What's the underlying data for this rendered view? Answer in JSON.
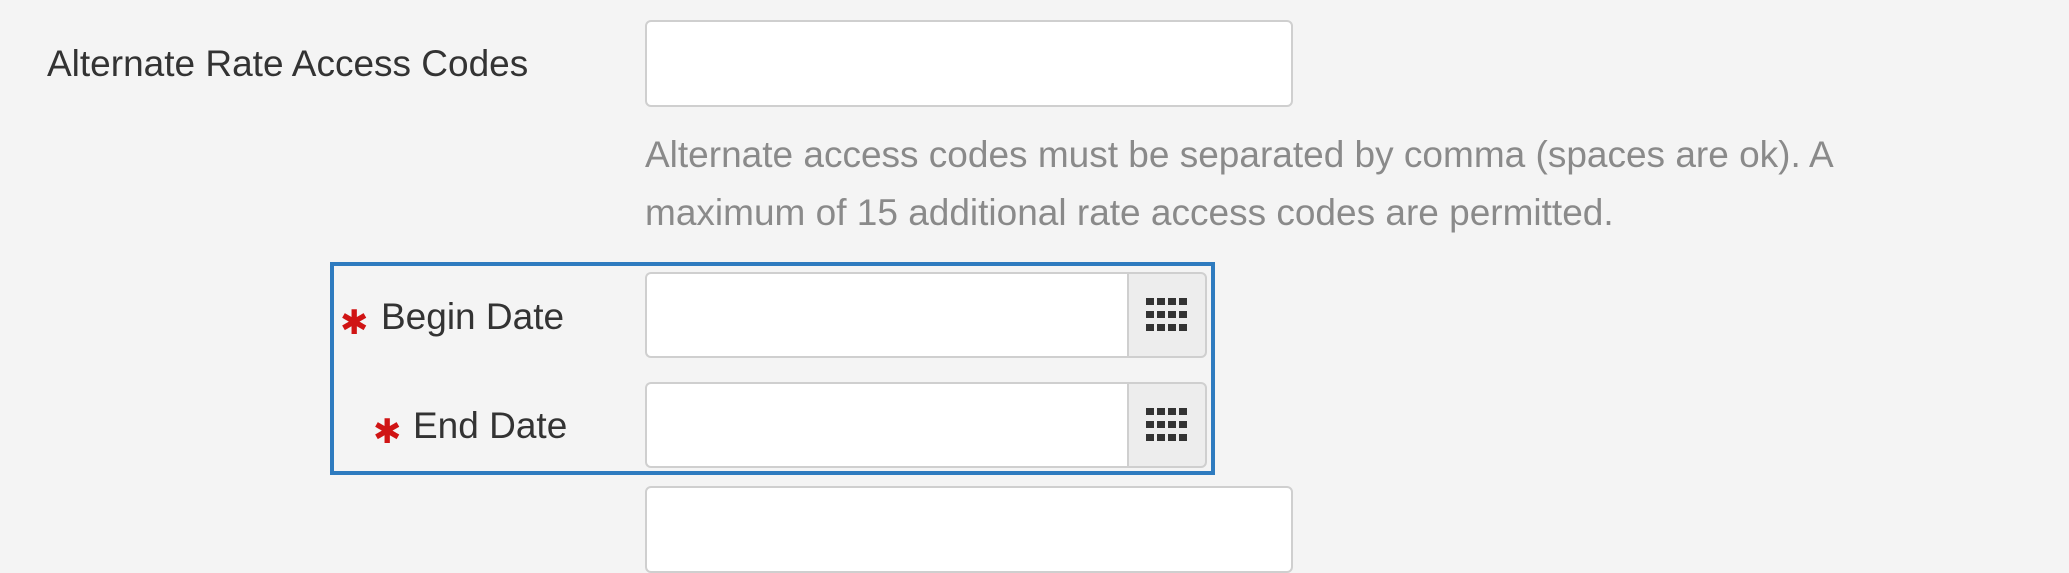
{
  "form": {
    "alt_codes": {
      "label": "Alternate Rate Access Codes",
      "value": "",
      "help_line_1": "Alternate access codes must be separated by comma (spaces are ok). A",
      "help_line_2": "maximum of 15 additional rate access codes are permitted."
    },
    "begin_date": {
      "required_mark": "✱",
      "label": "Begin Date",
      "value": "",
      "icon": "calendar-grid-icon"
    },
    "end_date": {
      "required_mark": "✱",
      "label": "End Date",
      "value": "",
      "icon": "calendar-grid-icon"
    }
  },
  "colors": {
    "background": "#f4f4f4",
    "label_text": "#333333",
    "help_text": "#8a8a8a",
    "required": "#d01414",
    "highlight_border": "#2e7bbf",
    "input_border": "#cfcfcf"
  }
}
